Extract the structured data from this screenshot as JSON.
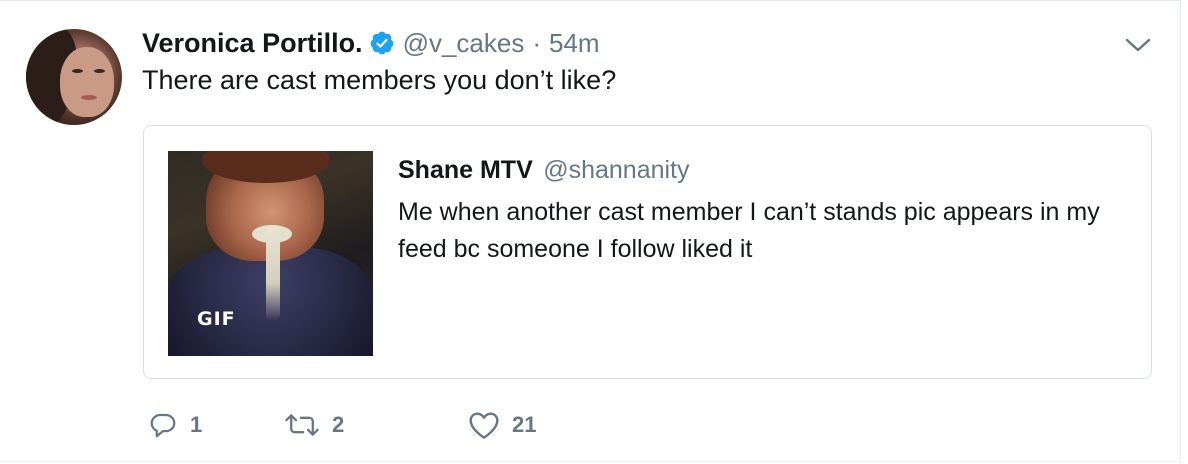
{
  "tweet": {
    "display_name": "Veronica Portillo.",
    "verified_icon": "verified-badge-icon",
    "handle": "@v_cakes",
    "separator": "·",
    "time": "54m",
    "text": "There are cast members you don’t like?",
    "menu_icon": "chevron-down-icon"
  },
  "quoted_tweet": {
    "display_name": "Shane MTV",
    "handle": "@shannanity",
    "text": "Me when another cast member I can’t stands pic appears in my feed bc someone I follow liked it",
    "media_badge": "GIF"
  },
  "actions": {
    "reply": {
      "icon": "reply-icon",
      "count": "1"
    },
    "retweet": {
      "icon": "retweet-icon",
      "count": "2"
    },
    "like": {
      "icon": "heart-icon",
      "count": "21"
    }
  },
  "colors": {
    "primary_text": "#14171a",
    "secondary_text": "#657786",
    "verified_blue": "#1da1f2",
    "border": "#e6ecf0"
  }
}
